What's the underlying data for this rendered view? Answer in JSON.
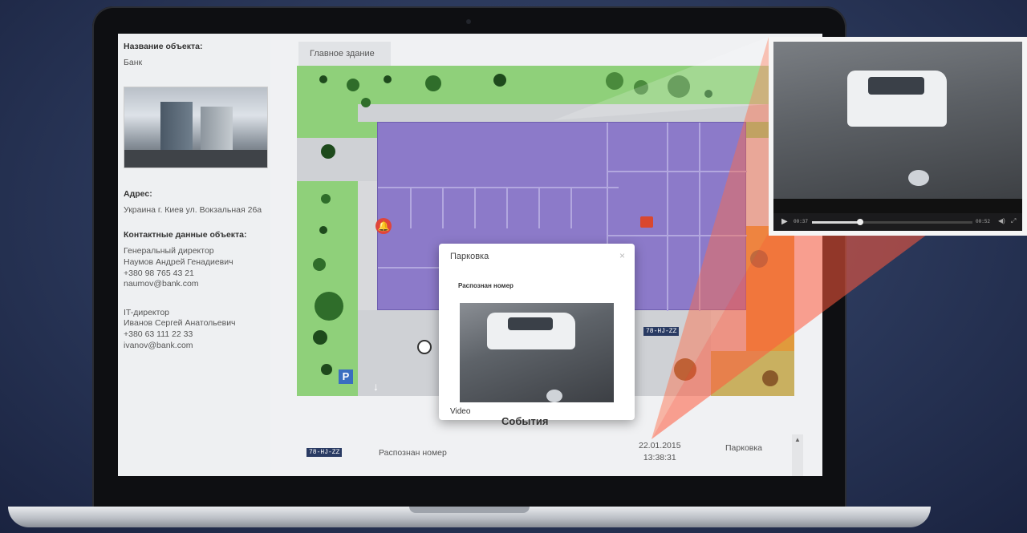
{
  "info": {
    "object_name_label": "Название объекта:",
    "object_name": "Банк",
    "address_label": "Адрес:",
    "address": "Украина г. Киев ул. Вокзальная 26а",
    "contacts_label": "Контактные данные объекта:",
    "contact1": {
      "role": "Генеральный директор",
      "name": "Наумов Андрей Генадиевич",
      "phone": "+380 98 765 43 21",
      "email": "naumov@bank.com"
    },
    "contact2": {
      "role": "IT-директор",
      "name": "Иванов Сергей Анатольевич",
      "phone": "+380 63 111 22 33",
      "email": "ivanov@bank.com"
    }
  },
  "map": {
    "tab_label": "Главное здание",
    "parking_sign": "P",
    "plate_badge": "78-HJ-ZZ"
  },
  "popup": {
    "title": "Парковка",
    "close": "×",
    "subtitle": "Распознан номер",
    "video_label": "Video"
  },
  "events": {
    "title": "События",
    "rows": [
      {
        "plate": "78-HJ-ZZ",
        "text": "Распознан номер",
        "date": "22.01.2015",
        "time": "13:38:31",
        "place": "Парковка"
      }
    ]
  },
  "camera_player": {
    "time_current": "00:37",
    "time_total": "00:52",
    "progress": 0.3
  },
  "colors": {
    "floor_plan": "#8c7ac9",
    "grass": "#8fd07a",
    "alarm": "#e0453a",
    "cone": "#ff5a3c"
  }
}
